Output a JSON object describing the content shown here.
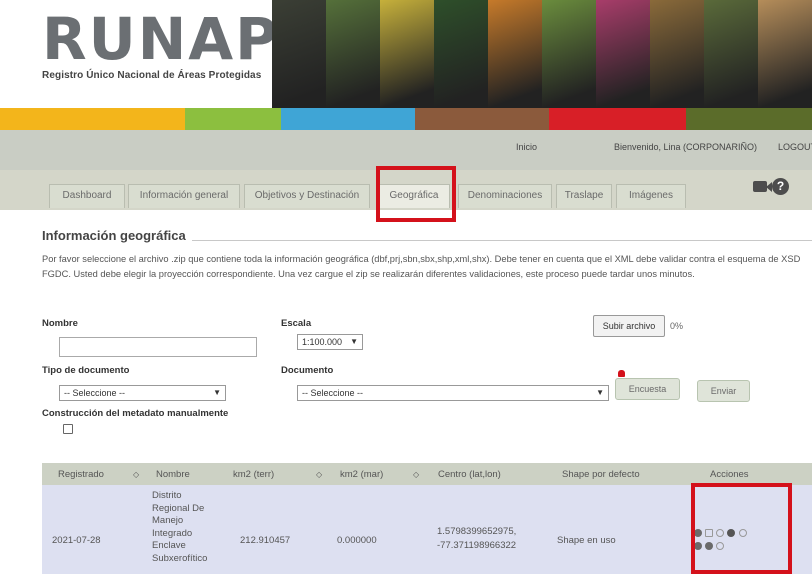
{
  "header": {
    "logo_text": "RUNAP",
    "logo_subtitle": "Registro Único Nacional de Áreas Protegidas"
  },
  "banner_colors": [
    "#3b3f35",
    "#55703a",
    "#c6b03b",
    "#2e4f2a",
    "#c67a2a",
    "#6a8c3d",
    "#a83d6a",
    "#8a6a3a",
    "#5a6a3a",
    "#b58d5a"
  ],
  "colorbar_colors": [
    "#f3b51b",
    "#8cbf3f",
    "#3fa5d6",
    "#8b5a3c",
    "#d81f27",
    "#5b6c2a"
  ],
  "topnav": {
    "inicio": "Inicio",
    "welcome": "Bienvenido, Lina (CORPONARIÑO)",
    "logout": "LOGOUT"
  },
  "tabs": [
    {
      "label": "Dashboard"
    },
    {
      "label": "Información general"
    },
    {
      "label": "Objetivos y Destinación"
    },
    {
      "label": "Geográfica"
    },
    {
      "label": "Denominaciones"
    },
    {
      "label": "Traslape"
    },
    {
      "label": "Imágenes"
    }
  ],
  "icons": {
    "video": "video-camera-icon",
    "help": "help-icon"
  },
  "section": {
    "title": "Información geográfica",
    "description": "Por favor seleccione el archivo .zip que contiene toda la información geográfica (dbf,prj,sbn,sbx,shp,xml,shx). Debe tener en cuenta que el XML debe validar contra el esquema de XSD FGDC. Usted debe elegir la proyección correspondiente. Una vez cargue el zip se realizarán diferentes validaciones, este proceso puede tardar unos minutos."
  },
  "form": {
    "nombre_label": "Nombre",
    "nombre_value": "",
    "escala_label": "Escala",
    "escala_value": "1:100.000",
    "upload_button": "Subir archivo",
    "upload_progress": "0%",
    "tipo_doc_label": "Tipo de documento",
    "tipo_doc_value": "-- Seleccione --",
    "documento_label": "Documento",
    "documento_value": "-- Seleccione --",
    "encuesta_button": "Encuesta",
    "enviar_button": "Enviar",
    "metadata_label": "Construcción del metadato manualmente"
  },
  "table": {
    "headers": [
      "Registrado",
      "Nombre",
      "km2 (terr)",
      "km2 (mar)",
      "Centro (lat,lon)",
      "Shape por defecto",
      "Acciones"
    ],
    "row": {
      "registrado": "2021-07-28",
      "nombre_lines": [
        "Distrito",
        "Regional De",
        "Manejo",
        "Integrado",
        "Enclave",
        "Subxerofítico"
      ],
      "km2_terr": "212.910457",
      "km2_mar": "0.000000",
      "centro_line1": "1.5798399652975,",
      "centro_line2": "-77.371198966322",
      "shape": "Shape en uso"
    }
  }
}
